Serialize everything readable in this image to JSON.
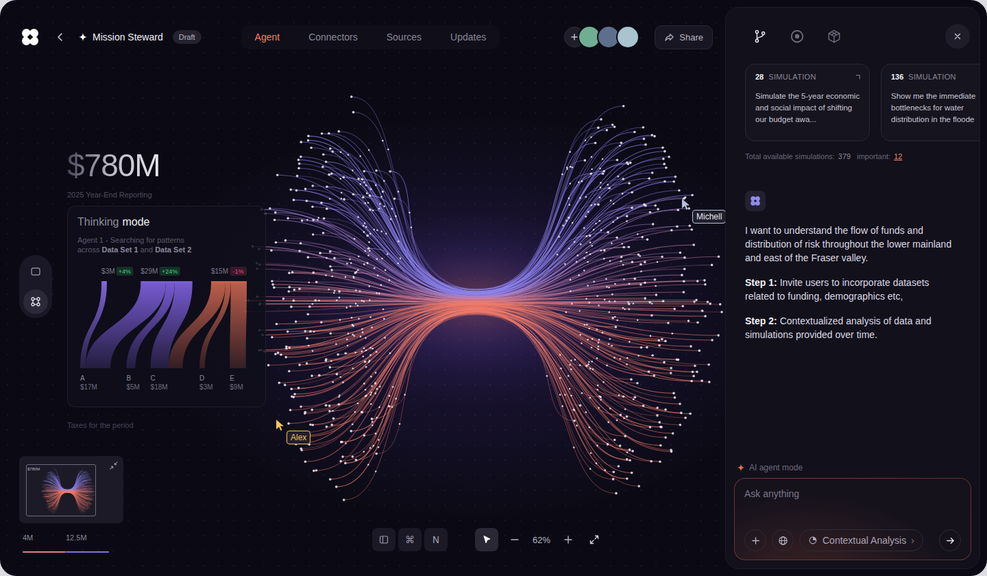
{
  "header": {
    "product": "Mission Steward",
    "status": "Draft",
    "tabs": [
      {
        "label": "Agent",
        "selected": true
      },
      {
        "label": "Connectors",
        "selected": false
      },
      {
        "label": "Sources",
        "selected": false
      },
      {
        "label": "Updates",
        "selected": false
      }
    ],
    "collaborators": [
      {
        "color": "#6fae93"
      },
      {
        "color": "#5d6f8c"
      },
      {
        "color": "#a9c3cf"
      }
    ],
    "share": "Share"
  },
  "rail": [
    {
      "selected": false
    },
    {
      "selected": true
    }
  ],
  "report": {
    "value": "$780M",
    "caption": "2025 Year-End Reporting",
    "footnote": "Taxes for the period"
  },
  "thinking": {
    "title_lead": "Thinking",
    "title_rest": "mode",
    "status": [
      {
        "text": "Agent 1 - Searching for patterns across ",
        "bold": false
      },
      {
        "text": "Data Set 1",
        "bold": true
      },
      {
        "text": " and ",
        "bold": false
      },
      {
        "text": "Data Set 2",
        "bold": true
      }
    ],
    "chart": {
      "sources": [
        {
          "label": "$3M",
          "change": "+4%",
          "change_color": "#3ecf7a",
          "color": "#8468e0"
        },
        {
          "label": "$29M",
          "change": "+24%",
          "change_color": "#3ecf7a",
          "color": "#7a5ed8"
        },
        {
          "label": "$15M",
          "change": "-1%",
          "change_color": "#e8467c",
          "color": "#c4614e"
        }
      ],
      "targets": [
        {
          "name": "A",
          "label": "$17M"
        },
        {
          "name": "B",
          "label": "$5M"
        },
        {
          "name": "C",
          "label": "$18M"
        },
        {
          "name": "D",
          "label": "$3M"
        },
        {
          "name": "E",
          "label": "$9M"
        }
      ],
      "flows": [
        {
          "from": 0,
          "to": 0,
          "value": 3
        },
        {
          "from": 1,
          "to": 0,
          "value": 14
        },
        {
          "from": 1,
          "to": 1,
          "value": 5
        },
        {
          "from": 1,
          "to": 2,
          "value": 10
        },
        {
          "from": 2,
          "to": 2,
          "value": 8
        },
        {
          "from": 2,
          "to": 3,
          "value": 3
        },
        {
          "from": 2,
          "to": 4,
          "value": 9
        }
      ]
    }
  },
  "cursors": [
    {
      "name": "Michell",
      "color": "#b4c0dc"
    },
    {
      "name": "Alex",
      "color": "#f2c45a"
    }
  ],
  "minimap": {
    "title": "$780M",
    "scale": [
      {
        "label": "4M",
        "color": "#e07a92"
      },
      {
        "label": "12.5M",
        "color": "#8a70e0"
      }
    ]
  },
  "toolbar": {
    "shortcuts": [
      "⌘",
      "N"
    ],
    "pointer_selected": true,
    "zoom": "62%"
  },
  "panel": {
    "tabs": [
      {
        "selected": true
      },
      {
        "selected": false
      },
      {
        "selected": false
      }
    ],
    "simulations": [
      {
        "count": "28",
        "kind": "SIMULATION",
        "text": "Simulate the 5-year economic and social impact of shifting our budget awa..."
      },
      {
        "count": "136",
        "kind": "SIMULATION",
        "text": "Show me the immediate bottlenecks for water distribution in the floode"
      }
    ],
    "totals": {
      "label": "Total available simulations:",
      "value": "379",
      "important_label": "important:",
      "important": "12"
    },
    "message": {
      "intro": "I want to understand the flow of funds and distribution of risk throughout the lower mainland and east of the Fraser valley.",
      "steps": [
        {
          "label": "Step 1:",
          "text": "Invite users to incorporate datasets related to funding, demographics etc,"
        },
        {
          "label": "Step 2:",
          "text": "Contextualized analysis of data and simulations provided over time."
        }
      ]
    },
    "composer": {
      "mode": "AI agent mode",
      "placeholder": "Ask anything",
      "tool": "Contextual Analysis",
      "chevron": "›"
    }
  }
}
